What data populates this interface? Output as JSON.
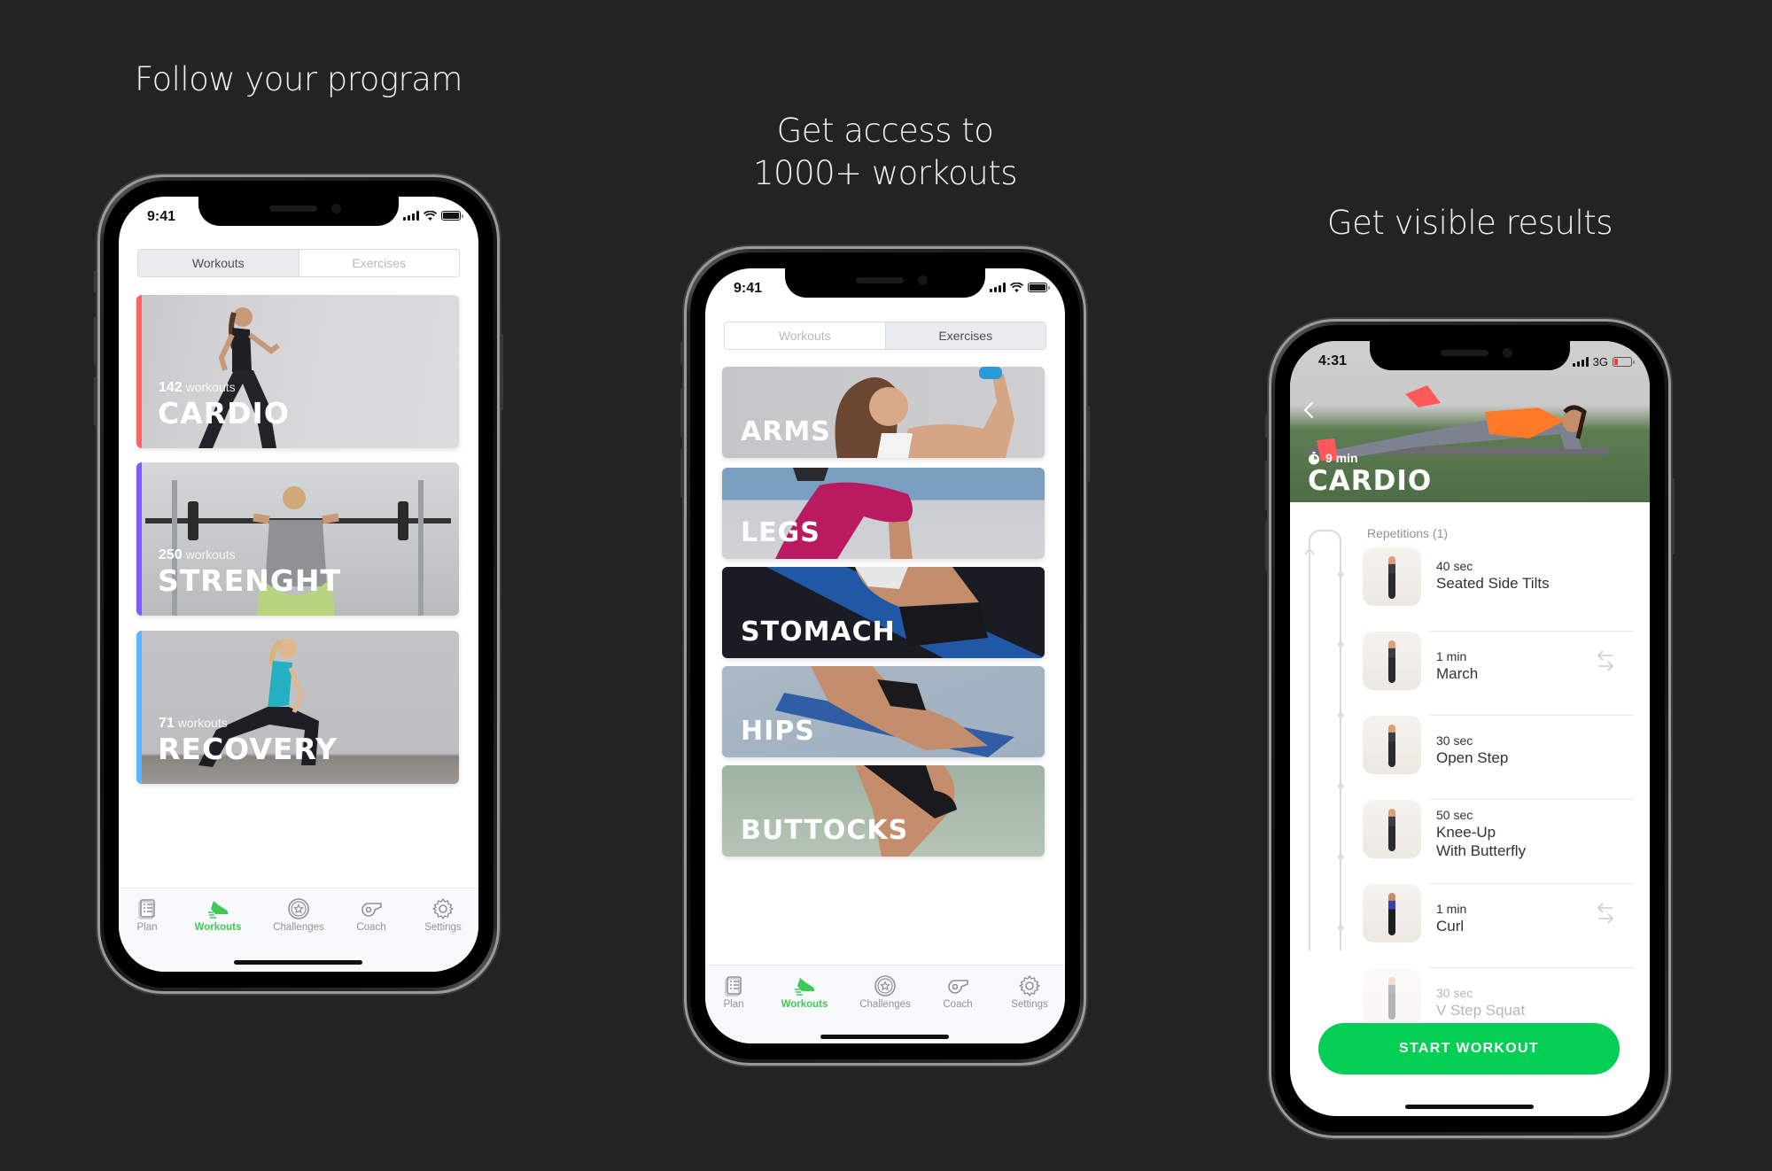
{
  "headlines": [
    "Follow your program",
    "Get access to 1000+ workouts",
    "Get visible results"
  ],
  "colors": {
    "background": "#232323",
    "accent_green": "#02cf53",
    "tab_active": "#3fc956",
    "cardio_accent": "#ff6363",
    "strength_accent": "#7b5cff",
    "recovery_accent": "#5bb8ff"
  },
  "phone1": {
    "status": {
      "time": "9:41"
    },
    "segmented": {
      "options": [
        "Workouts",
        "Exercises"
      ],
      "selected": "Workouts"
    },
    "categories": [
      {
        "count": "142",
        "count_label": "workouts",
        "title": "CARDIO"
      },
      {
        "count": "250",
        "count_label": "workouts",
        "title": "STRENGHT"
      },
      {
        "count": "71",
        "count_label": "workouts",
        "title": "RECOVERY"
      }
    ],
    "tabs": [
      {
        "label": "Plan",
        "icon": "plan-icon"
      },
      {
        "label": "Workouts",
        "icon": "sneaker-icon"
      },
      {
        "label": "Challenges",
        "icon": "medal-icon"
      },
      {
        "label": "Coach",
        "icon": "whistle-icon"
      },
      {
        "label": "Settings",
        "icon": "gear-icon"
      }
    ],
    "active_tab": "Workouts"
  },
  "phone2": {
    "status": {
      "time": "9:41"
    },
    "segmented": {
      "options": [
        "Workouts",
        "Exercises"
      ],
      "selected": "Exercises"
    },
    "body_parts": [
      "ARMS",
      "LEGS",
      "STOMACH",
      "HIPS",
      "BUTTOCKS"
    ],
    "tabs": [
      {
        "label": "Plan",
        "icon": "plan-icon"
      },
      {
        "label": "Workouts",
        "icon": "sneaker-icon"
      },
      {
        "label": "Challenges",
        "icon": "medal-icon"
      },
      {
        "label": "Coach",
        "icon": "whistle-icon"
      },
      {
        "label": "Settings",
        "icon": "gear-icon"
      }
    ],
    "active_tab": "Workouts"
  },
  "phone3": {
    "status": {
      "time": "4:31",
      "network": "3G"
    },
    "duration": "9 min",
    "title": "CARDIO",
    "section_label": "Repetitions (1)",
    "exercises": [
      {
        "duration": "40 sec",
        "name": "Seated Side Tilts",
        "swappable": false
      },
      {
        "duration": "1 min",
        "name": "March",
        "swappable": true
      },
      {
        "duration": "30 sec",
        "name": "Open Step",
        "swappable": false
      },
      {
        "duration": "50 sec",
        "name": "Knee-Up\nWith Butterfly",
        "swappable": false
      },
      {
        "duration": "1 min",
        "name": "Curl",
        "swappable": true
      },
      {
        "duration": "30 sec",
        "name": "V Step Squat",
        "swappable": false
      }
    ],
    "start_button": "START WORKOUT"
  }
}
